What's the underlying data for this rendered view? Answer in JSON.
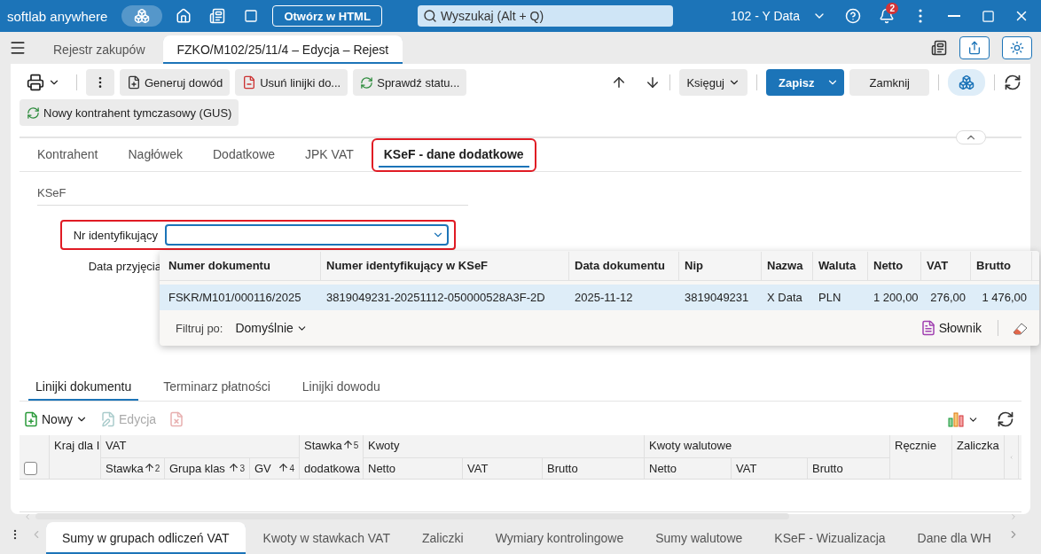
{
  "topbar": {
    "brand": "softlab anywhere",
    "html_button": "Otwórz w HTML",
    "search": {
      "placeholder": "Wyszukaj (Alt + Q)"
    },
    "company": "102 - Y Data",
    "notifications": "2"
  },
  "doc_tabs": [
    {
      "label": "Rejestr zakupów",
      "selected": false
    },
    {
      "label": "FZKO/M102/25/11/4 – Edycja – Rejest",
      "selected": true
    }
  ],
  "toolbar": {
    "buttons": [
      {
        "label": "Generuj dowód",
        "kind": "generate"
      },
      {
        "label": "Usuń linijki do...",
        "kind": "remove"
      },
      {
        "label": "Sprawdź statu...",
        "kind": "check"
      }
    ],
    "post": "Księguj",
    "save": "Zapisz",
    "close": "Zamknij",
    "second_row": [
      {
        "label": "Nowy kontrahent tymczasowy (GUS)",
        "kind": "check"
      }
    ]
  },
  "form_tabs": [
    {
      "label": "Kontrahent",
      "selected": false,
      "highlighted": false
    },
    {
      "label": "Nagłówek",
      "selected": false,
      "highlighted": false
    },
    {
      "label": "Dodatkowe",
      "selected": false,
      "highlighted": false
    },
    {
      "label": "JPK VAT",
      "selected": false,
      "highlighted": false
    },
    {
      "label": "KSeF - dane dodatkowe",
      "selected": true,
      "highlighted": true
    }
  ],
  "section": {
    "title": "KSeF",
    "fields": [
      {
        "label": "Nr identyfikujący",
        "kind": "combo",
        "focused": true,
        "highlighted": true
      },
      {
        "label": "Data przyjęcia",
        "kind": "plain",
        "highlighted": false
      }
    ]
  },
  "dropdown": {
    "columns": [
      "Numer dokumentu",
      "Numer identyfikujący w KSeF",
      "Data dokumentu",
      "Nip",
      "Nazwa",
      "Waluta",
      "Netto",
      "VAT",
      "Brutto"
    ],
    "rows": [
      {
        "selected": true,
        "cells": [
          "FSKR/M101/000116/2025",
          "3819049231-20251112-050000528A3F-2D",
          "2025-11-12",
          "3819049231",
          "X Data",
          "PLN",
          "1 200,00",
          "276,00",
          "1 476,00"
        ]
      }
    ],
    "filter_label": "Filtruj po:",
    "filter_value": "Domyślnie",
    "dictionary": "Słownik"
  },
  "line_tabs": [
    {
      "label": "Linijki dokumentu",
      "selected": true
    },
    {
      "label": "Terminarz płatności",
      "selected": false
    },
    {
      "label": "Linijki dowodu",
      "selected": false
    }
  ],
  "grid_toolbar": [
    {
      "label": "Nowy",
      "kind": "new",
      "disabled": false
    },
    {
      "label": "Edycja",
      "kind": "edit",
      "disabled": true
    },
    {
      "kind": "delete",
      "disabled": true
    }
  ],
  "select_all": {
    "checked": false
  },
  "grid_header": [
    {
      "kind": "single",
      "label": "Kraj dla I"
    },
    {
      "kind": "group",
      "label": "VAT",
      "columns": [
        {
          "label": "Stawka",
          "sort": "2"
        },
        {
          "label": "Grupa klas",
          "sort": "3"
        },
        {
          "label": "GV",
          "sort": "4"
        }
      ]
    },
    {
      "kind": "split",
      "label": "Stawka",
      "sort": "5",
      "sub_label": "dodatkowa"
    },
    {
      "kind": "group",
      "label": "Kwoty",
      "columns": [
        {
          "label": "Netto"
        },
        {
          "label": "VAT"
        },
        {
          "label": "Brutto"
        }
      ]
    },
    {
      "kind": "group",
      "label": "Kwoty walutowe",
      "columns": [
        {
          "label": "Netto"
        },
        {
          "label": "VAT"
        },
        {
          "label": "Brutto"
        }
      ]
    },
    {
      "kind": "single",
      "label": "Ręcznie"
    },
    {
      "kind": "single",
      "label": "Zaliczka"
    }
  ],
  "bottom_tabs": [
    {
      "label": "Sumy w grupach odliczeń VAT",
      "selected": true
    },
    {
      "label": "Kwoty w stawkach VAT",
      "selected": false
    },
    {
      "label": "Zaliczki",
      "selected": false
    },
    {
      "label": "Wymiary kontrolingowe",
      "selected": false
    },
    {
      "label": "Sumy walutowe",
      "selected": false
    },
    {
      "label": "KSeF - Wizualizacja",
      "selected": false
    },
    {
      "label": "Dane dla WH",
      "selected": false
    }
  ]
}
